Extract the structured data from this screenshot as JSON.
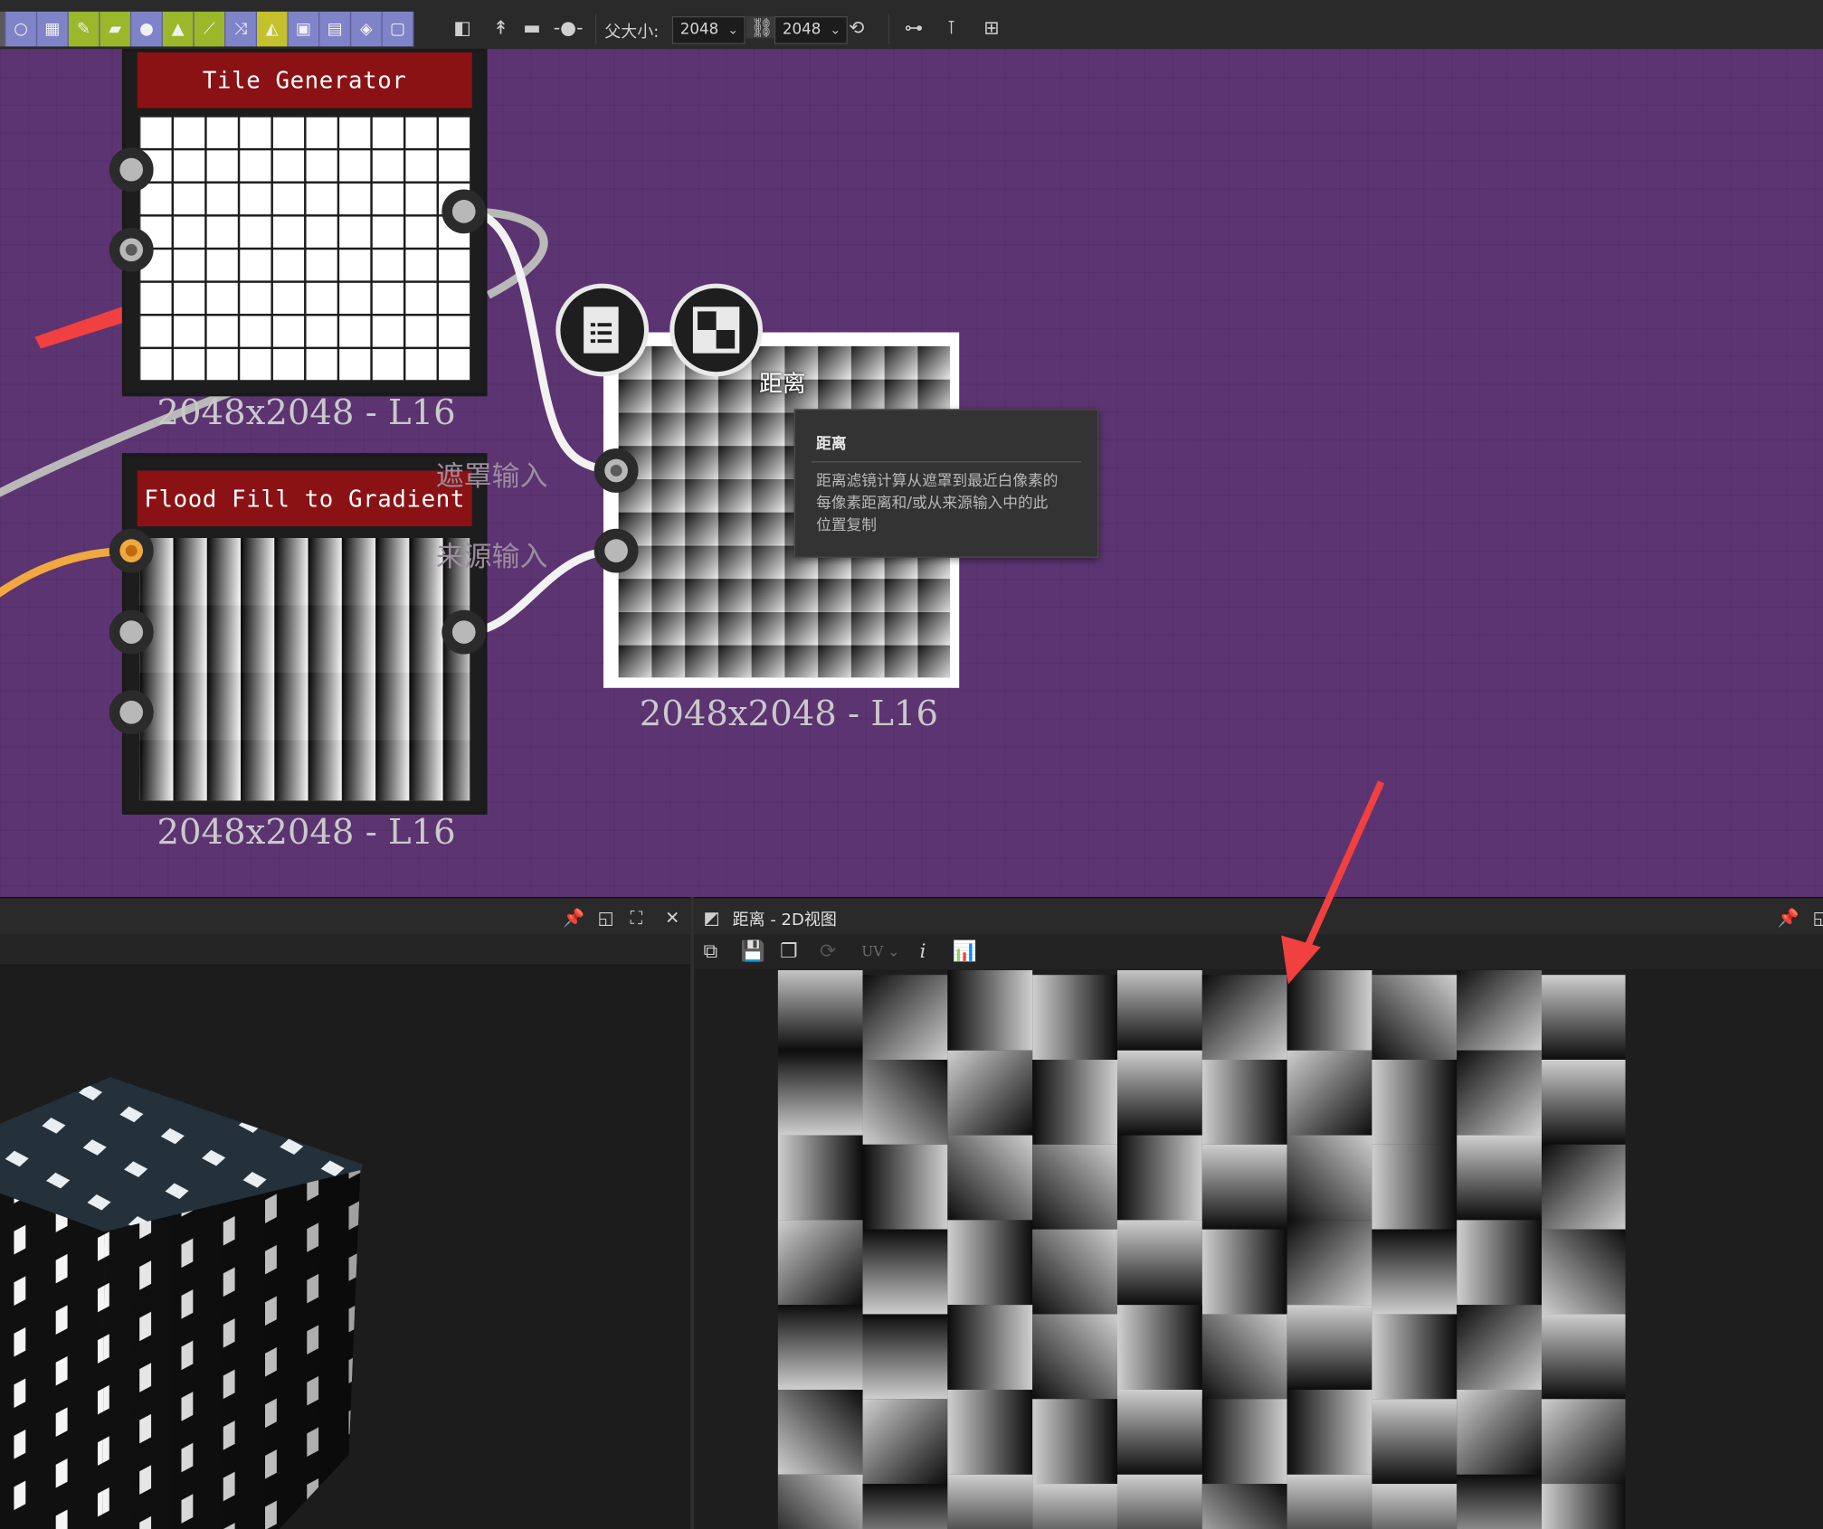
{
  "toolbar": {
    "parent_size_label": "父大小:",
    "size_x": "2048",
    "size_y": "2048",
    "tools": [
      "circle-icon",
      "bitmap-icon",
      "svg-icon",
      "uniform-color-icon",
      "blend-icon",
      "histogram-icon",
      "curve-icon",
      "shuffle-icon",
      "warp-icon",
      "transform-icon",
      "crop-icon",
      "mask-icon",
      "frame-icon"
    ]
  },
  "graph": {
    "nodes": [
      {
        "title": "Tile Generator",
        "size": "2048x2048 - L16"
      },
      {
        "title": "Flood Fill to Gradient",
        "size": "2048x2048 - L16"
      },
      {
        "caption": "距离",
        "size": "2048x2048 - L16"
      }
    ],
    "ports": {
      "mask_input": "遮罩输入",
      "source_input": "来源输入"
    },
    "tooltip": {
      "title": "距离",
      "body_lines": [
        "距离滤镜计算从遮罩到最近白像素的",
        "每像素距离和/或从来源输入中的此",
        "位置复制"
      ]
    },
    "colors": {
      "canvas": "#5c3472",
      "node_title": "#8b1214",
      "annotation_arrow": "#f04040",
      "wire_orange": "#f0a840"
    }
  },
  "view2d": {
    "title": "距离 - 2D视图",
    "uv_label": "UV"
  }
}
